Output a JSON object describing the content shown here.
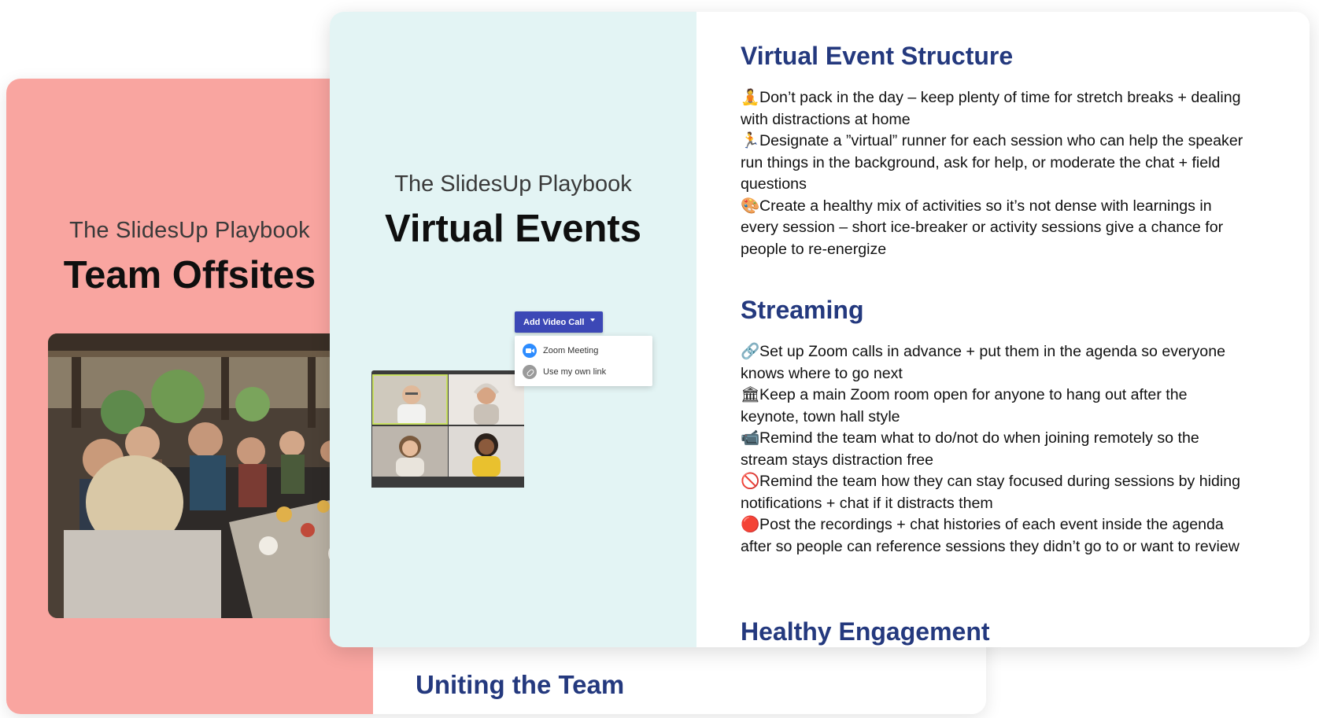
{
  "back_card": {
    "kicker": "The SlidesUp Playbook",
    "title": "Team Offsites",
    "photo": "group-dinner-photo",
    "section_heading": "Uniting the Team",
    "colors": {
      "panel": "#f9a5a0",
      "heading": "#24397e"
    }
  },
  "front_card": {
    "kicker": "The SlidesUp Playbook",
    "title": "Virtual Events",
    "colors": {
      "panel": "#e3f4f4",
      "heading": "#24397e",
      "button": "#3c48b6"
    },
    "video_widget": {
      "button_label": "Add Video Call",
      "menu": [
        {
          "label": "Zoom Meeting",
          "icon": "zoom-icon"
        },
        {
          "label": "Use my own link",
          "icon": "link-icon"
        }
      ]
    },
    "sections": [
      {
        "title": "Virtual Event Structure",
        "bullets": [
          {
            "emoji": "🧘",
            "text": "Don’t pack in the day – keep plenty of time for stretch breaks + dealing with distractions at home"
          },
          {
            "emoji": "🏃",
            "text": "Designate a ”virtual” runner for each session who can help the speaker run things in the background, ask for help, or moderate the chat + field questions"
          },
          {
            "emoji": "🎨",
            "text": "Create a healthy mix of activities so it’s not dense with learnings in every session – short ice-breaker or activity sessions give a chance for people to re-energize"
          }
        ]
      },
      {
        "title": "Streaming",
        "bullets": [
          {
            "emoji": "🔗",
            "text": "Set up Zoom calls in advance + put them in the agenda so everyone knows where to go next"
          },
          {
            "emoji": "🏛",
            "text": "Keep a main Zoom room open for anyone to hang out after the keynote, town hall style"
          },
          {
            "emoji": "📹",
            "text": "Remind the team what to do/not do when joining remotely so the stream stays distraction free"
          },
          {
            "emoji": "🚫",
            "text": "Remind the team how they can stay focused during sessions by hiding notifications + chat if it distracts them"
          },
          {
            "emoji": "🔴",
            "text": "Post the recordings + chat histories of each event inside the agenda after so people can reference sessions they didn’t go to or want to review"
          }
        ]
      },
      {
        "title": "Healthy Engagement",
        "bullets": []
      }
    ]
  }
}
